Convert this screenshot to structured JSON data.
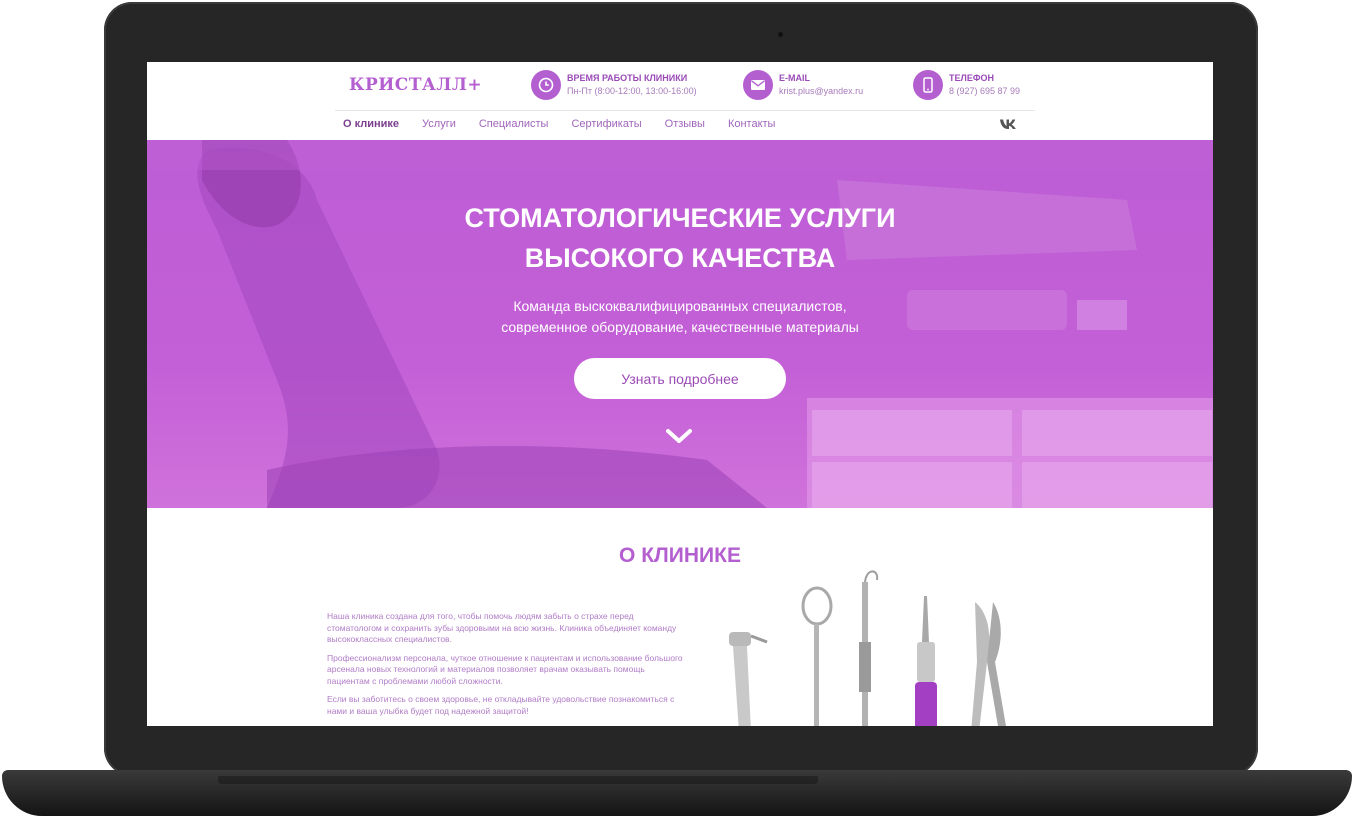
{
  "header": {
    "logo": "КРИСТАЛЛ+",
    "hours_title": "ВРЕМЯ РАБОТЫ КЛИНИКИ",
    "hours_value": "Пн-Пт (8:00-12:00, 13:00-16:00)",
    "email_title": "E-MAIL",
    "email_value": "krist.plus@yandex.ru",
    "phone_title": "ТЕЛЕФОН",
    "phone_value": "8 (927) 695 87 99"
  },
  "nav": {
    "items": [
      "О клинике",
      "Услуги",
      "Специалисты",
      "Сертификаты",
      "Отзывы",
      "Контакты"
    ],
    "active": "О клинике",
    "vk_label": "VK"
  },
  "hero": {
    "title_line1": "СТОМАТОЛОГИЧЕСКИЕ УСЛУГИ",
    "title_line2": "ВЫСОКОГО КАЧЕСТВА",
    "subtitle_line1": "Команда выскоквалифицированных специалистов,",
    "subtitle_line2": "современное оборудование, качественные материалы",
    "button": "Узнать подробнее"
  },
  "about": {
    "title": "О КЛИНИКЕ",
    "p1": "Наша клиника создана для того, чтобы помочь людям забыть о страхе перед стоматологом и сохранить зубы здоровыми на всю жизнь. Клиника объединяет команду высококлассных специалистов.",
    "p2": "Профессионализм персонала, чуткое отношение к пациентам и использование большого арсенала новых технологий и материалов позволяет врачам оказывать помощь пациентам с проблемами любой сложности.",
    "p3": "Если вы заботитесь о своем здоровье, не откладывайте удовольствие познакомиться с нами и ваша улыбка будет под надежной защитой!"
  },
  "colors": {
    "accent": "#b45fd0",
    "hero": "#c35fd7",
    "laptop": "#262626"
  },
  "icons": [
    "clock-icon",
    "mail-icon",
    "phone-icon",
    "vk-icon",
    "chevron-down-icon"
  ]
}
